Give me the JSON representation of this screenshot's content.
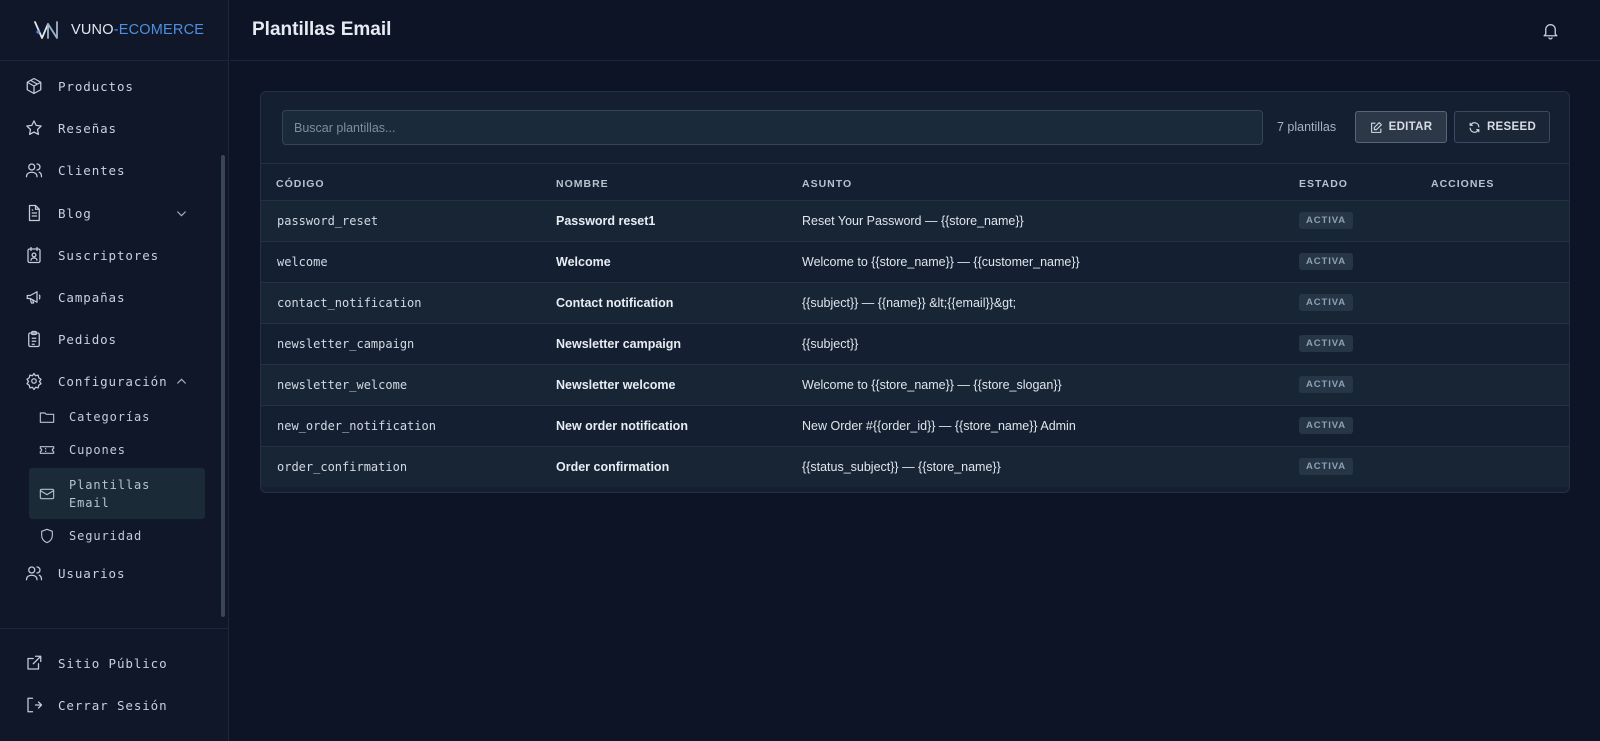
{
  "brand": {
    "prefix": "VUNO",
    "suffix": "-ECOMERCE"
  },
  "sidebar": {
    "items": [
      {
        "label": "Productos",
        "icon": "box-icon"
      },
      {
        "label": "Reseñas",
        "icon": "star-icon"
      },
      {
        "label": "Clientes",
        "icon": "users-icon"
      },
      {
        "label": "Blog",
        "icon": "document-icon",
        "expandable": true,
        "expanded": false
      },
      {
        "label": "Suscriptores",
        "icon": "contact-card-icon"
      },
      {
        "label": "Campañas",
        "icon": "megaphone-icon"
      },
      {
        "label": "Pedidos",
        "icon": "clipboard-icon"
      },
      {
        "label": "Configuración",
        "icon": "gear-icon",
        "expandable": true,
        "expanded": true
      },
      {
        "label": "Usuarios",
        "icon": "users-icon"
      }
    ],
    "config_sub": [
      {
        "label": "Categorías",
        "icon": "folder-icon"
      },
      {
        "label": "Cupones",
        "icon": "ticket-icon"
      },
      {
        "label": "Plantillas Email",
        "icon": "mail-icon",
        "active": true
      },
      {
        "label": "Seguridad",
        "icon": "shield-icon"
      }
    ],
    "footer": [
      {
        "label": "Sitio Público",
        "icon": "external-link-icon"
      },
      {
        "label": "Cerrar Sesión",
        "icon": "logout-icon"
      }
    ]
  },
  "header": {
    "title": "Plantillas Email",
    "bell_icon": "bell-icon"
  },
  "toolbar": {
    "search_placeholder": "Buscar plantillas...",
    "count": "7 plantillas",
    "edit_label": "EDITAR",
    "reseed_label": "RESEED"
  },
  "table": {
    "headers": [
      "CÓDIGO",
      "NOMBRE",
      "ASUNTO",
      "ESTADO",
      "ACCIONES"
    ],
    "rows": [
      {
        "code": "password_reset",
        "name": "Password reset1",
        "subject": "Reset Your Password — {{store_name}}",
        "status": "ACTIVA"
      },
      {
        "code": "welcome",
        "name": "Welcome",
        "subject": "Welcome to {{store_name}} — {{customer_name}}",
        "status": "ACTIVA"
      },
      {
        "code": "contact_notification",
        "name": "Contact notification",
        "subject": "{{subject}} — {{name}} &lt;{{email}}&gt;",
        "status": "ACTIVA"
      },
      {
        "code": "newsletter_campaign",
        "name": "Newsletter campaign",
        "subject": "{{subject}}",
        "status": "ACTIVA"
      },
      {
        "code": "newsletter_welcome",
        "name": "Newsletter welcome",
        "subject": "Welcome to {{store_name}} — {{store_slogan}}",
        "status": "ACTIVA"
      },
      {
        "code": "new_order_notification",
        "name": "New order notification",
        "subject": "New Order #{{order_id}} — {{store_name}} Admin",
        "status": "ACTIVA"
      },
      {
        "code": "order_confirmation",
        "name": "Order confirmation",
        "subject": "{{status_subject}} — {{store_name}}",
        "status": "ACTIVA"
      }
    ]
  },
  "colors": {
    "background": "#0d1426",
    "card": "#142031",
    "accent": "#4f8fe0",
    "badge": "#263646"
  }
}
